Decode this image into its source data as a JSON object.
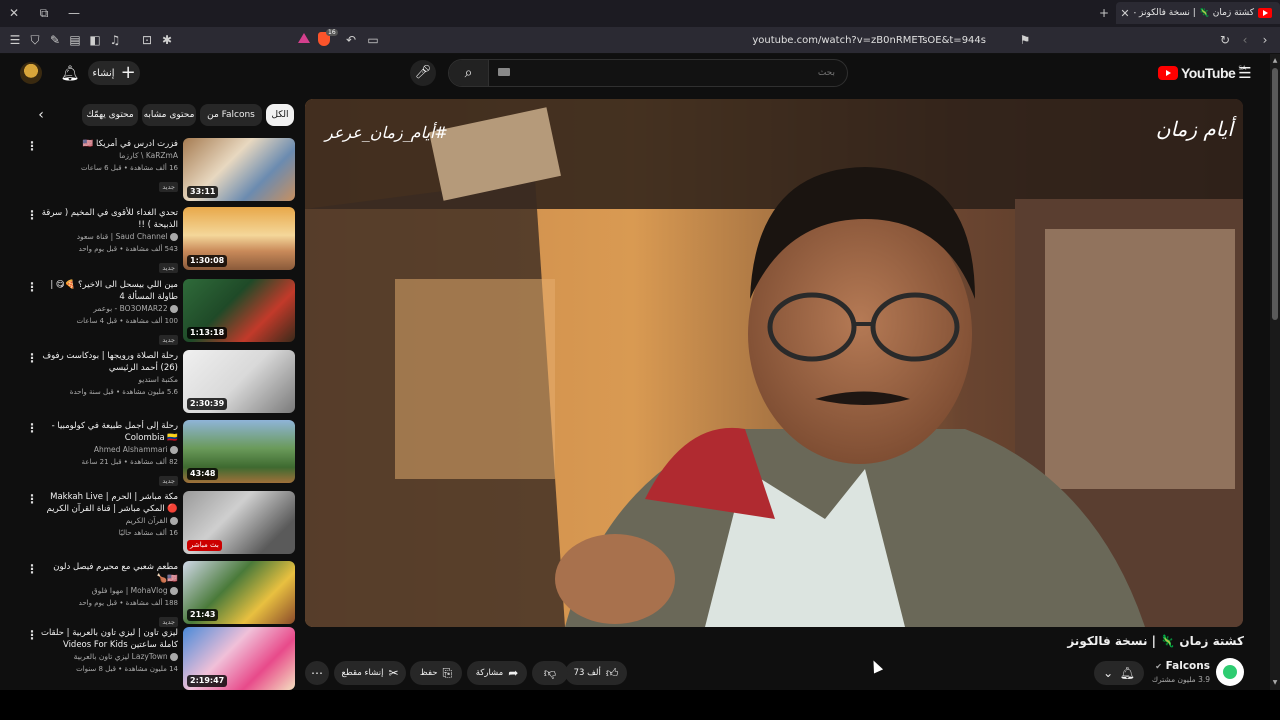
{
  "browser": {
    "tab_title": "كشتة زمان 🦎 | نسخة فالكونز - YouTube",
    "url": "youtube.com/watch?v=zB0nRMETsOE&t=944s",
    "brave_badge": "16"
  },
  "header": {
    "create_label": "إنشاء",
    "search_placeholder": "بحث",
    "logo_text": "YouTube",
    "country": "SA"
  },
  "chips": [
    "الكل",
    "من Falcons",
    "محتوى مشابه",
    "محتوى يهمّك"
  ],
  "videos": [
    {
      "title": "فزرت ادرس في أمريكا 🇺🇸",
      "channel": "KaRZmA \\ كارزما",
      "stats": "16 ألف مشاهدة • قبل 6 ساعات",
      "badge": "جديد",
      "duration": "33:11"
    },
    {
      "title": "تحدي الغداء للأقوى في المخيم ( سرقة الذبيحة ) !!",
      "channel": "Saud Channel | قناة سعود",
      "stats": "543 ألف مشاهدة • قبل يوم واحد",
      "badge": "جديد",
      "duration": "1:30:08"
    },
    {
      "title": "مين اللي بيسحل الى الاخير؟ 🍕😋 | طاولة المسألة 4",
      "channel": "BO3OMAR22 - بوعمر",
      "stats": "100 ألف مشاهدة • قبل 4 ساعات",
      "badge": "جديد",
      "duration": "1:13:18"
    },
    {
      "title": "رحلة الصلاة ورويجها | بودكاست رفوف (26) أحمد الرئيسي",
      "channel": "مكتبة استديو",
      "stats": "5.6 مليون مشاهدة • قبل سنة واحدة",
      "badge": "",
      "duration": "2:30:39"
    },
    {
      "title": "رحلة إلى أجمل طبيعة في كولومبيا - Colombia 🇨🇴",
      "channel": "Ahmed Alshammari",
      "stats": "82 ألف مشاهدة • قبل 21 ساعة",
      "badge": "جديد",
      "duration": "43:48"
    },
    {
      "title": "مكة مباشر | الحرم | Makkah Live 🔴 المكي مباشر | قناة القرآن الكريم السعودية ...",
      "channel": "القرآن الكريم",
      "stats": "16 ألف مشاهد حاليًا",
      "badge": "",
      "live": "بث مباشر"
    },
    {
      "title": "مطعم شعبي مع محيرم فيصل دلون 🇺🇸🍗",
      "channel": "MohaVlog | مهوا فلوق",
      "stats": "188 ألف مشاهدة • قبل يوم واحد",
      "badge": "جديد",
      "duration": "21:43"
    },
    {
      "title": "ليزي تاون | ليزي تاون بالعربية | حلقات كاملة ساعتين Videos For Kids",
      "channel": "LazyTown ليزي تاون بالعربية",
      "stats": "14 مليون مشاهدة • قبل 8 سنوات",
      "badge": "",
      "duration": "2:19:47"
    }
  ],
  "player": {
    "hashtag": "#أيام_زمان_عرعر",
    "watermark": "أيام زمان"
  },
  "video": {
    "title": "كشتة زمان 🦎 | نسخة فالكونز",
    "channel": "Falcons",
    "subscribers": "3.9 مليون مشترك",
    "likes": "73 ألف",
    "share": "مشاركة",
    "save": "حفظ",
    "clip": "إنشاء مقطع"
  }
}
